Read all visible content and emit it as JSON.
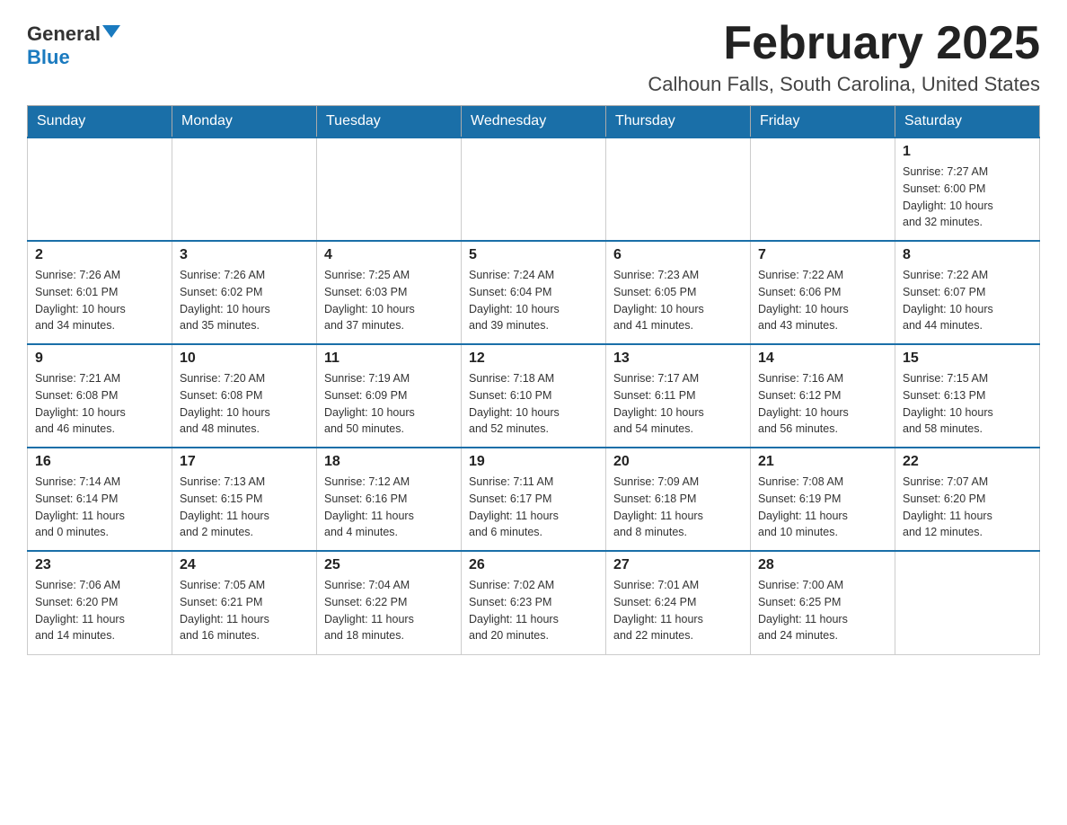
{
  "logo": {
    "general": "General",
    "blue": "Blue"
  },
  "title": "February 2025",
  "location": "Calhoun Falls, South Carolina, United States",
  "days_of_week": [
    "Sunday",
    "Monday",
    "Tuesday",
    "Wednesday",
    "Thursday",
    "Friday",
    "Saturday"
  ],
  "weeks": [
    [
      {
        "day": "",
        "info": ""
      },
      {
        "day": "",
        "info": ""
      },
      {
        "day": "",
        "info": ""
      },
      {
        "day": "",
        "info": ""
      },
      {
        "day": "",
        "info": ""
      },
      {
        "day": "",
        "info": ""
      },
      {
        "day": "1",
        "info": "Sunrise: 7:27 AM\nSunset: 6:00 PM\nDaylight: 10 hours\nand 32 minutes."
      }
    ],
    [
      {
        "day": "2",
        "info": "Sunrise: 7:26 AM\nSunset: 6:01 PM\nDaylight: 10 hours\nand 34 minutes."
      },
      {
        "day": "3",
        "info": "Sunrise: 7:26 AM\nSunset: 6:02 PM\nDaylight: 10 hours\nand 35 minutes."
      },
      {
        "day": "4",
        "info": "Sunrise: 7:25 AM\nSunset: 6:03 PM\nDaylight: 10 hours\nand 37 minutes."
      },
      {
        "day": "5",
        "info": "Sunrise: 7:24 AM\nSunset: 6:04 PM\nDaylight: 10 hours\nand 39 minutes."
      },
      {
        "day": "6",
        "info": "Sunrise: 7:23 AM\nSunset: 6:05 PM\nDaylight: 10 hours\nand 41 minutes."
      },
      {
        "day": "7",
        "info": "Sunrise: 7:22 AM\nSunset: 6:06 PM\nDaylight: 10 hours\nand 43 minutes."
      },
      {
        "day": "8",
        "info": "Sunrise: 7:22 AM\nSunset: 6:07 PM\nDaylight: 10 hours\nand 44 minutes."
      }
    ],
    [
      {
        "day": "9",
        "info": "Sunrise: 7:21 AM\nSunset: 6:08 PM\nDaylight: 10 hours\nand 46 minutes."
      },
      {
        "day": "10",
        "info": "Sunrise: 7:20 AM\nSunset: 6:08 PM\nDaylight: 10 hours\nand 48 minutes."
      },
      {
        "day": "11",
        "info": "Sunrise: 7:19 AM\nSunset: 6:09 PM\nDaylight: 10 hours\nand 50 minutes."
      },
      {
        "day": "12",
        "info": "Sunrise: 7:18 AM\nSunset: 6:10 PM\nDaylight: 10 hours\nand 52 minutes."
      },
      {
        "day": "13",
        "info": "Sunrise: 7:17 AM\nSunset: 6:11 PM\nDaylight: 10 hours\nand 54 minutes."
      },
      {
        "day": "14",
        "info": "Sunrise: 7:16 AM\nSunset: 6:12 PM\nDaylight: 10 hours\nand 56 minutes."
      },
      {
        "day": "15",
        "info": "Sunrise: 7:15 AM\nSunset: 6:13 PM\nDaylight: 10 hours\nand 58 minutes."
      }
    ],
    [
      {
        "day": "16",
        "info": "Sunrise: 7:14 AM\nSunset: 6:14 PM\nDaylight: 11 hours\nand 0 minutes."
      },
      {
        "day": "17",
        "info": "Sunrise: 7:13 AM\nSunset: 6:15 PM\nDaylight: 11 hours\nand 2 minutes."
      },
      {
        "day": "18",
        "info": "Sunrise: 7:12 AM\nSunset: 6:16 PM\nDaylight: 11 hours\nand 4 minutes."
      },
      {
        "day": "19",
        "info": "Sunrise: 7:11 AM\nSunset: 6:17 PM\nDaylight: 11 hours\nand 6 minutes."
      },
      {
        "day": "20",
        "info": "Sunrise: 7:09 AM\nSunset: 6:18 PM\nDaylight: 11 hours\nand 8 minutes."
      },
      {
        "day": "21",
        "info": "Sunrise: 7:08 AM\nSunset: 6:19 PM\nDaylight: 11 hours\nand 10 minutes."
      },
      {
        "day": "22",
        "info": "Sunrise: 7:07 AM\nSunset: 6:20 PM\nDaylight: 11 hours\nand 12 minutes."
      }
    ],
    [
      {
        "day": "23",
        "info": "Sunrise: 7:06 AM\nSunset: 6:20 PM\nDaylight: 11 hours\nand 14 minutes."
      },
      {
        "day": "24",
        "info": "Sunrise: 7:05 AM\nSunset: 6:21 PM\nDaylight: 11 hours\nand 16 minutes."
      },
      {
        "day": "25",
        "info": "Sunrise: 7:04 AM\nSunset: 6:22 PM\nDaylight: 11 hours\nand 18 minutes."
      },
      {
        "day": "26",
        "info": "Sunrise: 7:02 AM\nSunset: 6:23 PM\nDaylight: 11 hours\nand 20 minutes."
      },
      {
        "day": "27",
        "info": "Sunrise: 7:01 AM\nSunset: 6:24 PM\nDaylight: 11 hours\nand 22 minutes."
      },
      {
        "day": "28",
        "info": "Sunrise: 7:00 AM\nSunset: 6:25 PM\nDaylight: 11 hours\nand 24 minutes."
      },
      {
        "day": "",
        "info": ""
      }
    ]
  ]
}
